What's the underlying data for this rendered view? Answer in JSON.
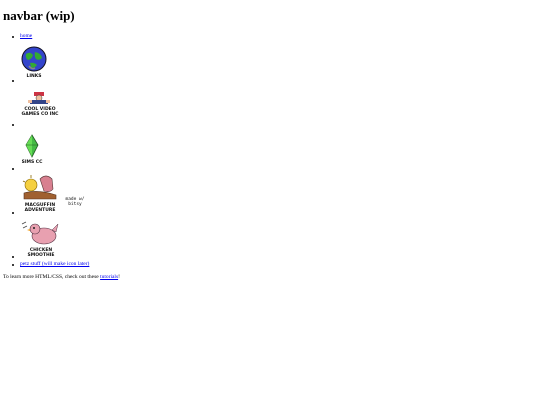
{
  "header": {
    "title": "navbar (wip)"
  },
  "nav": {
    "home_label": "home",
    "links_label": "LINKS",
    "cool_video_games_label": "COOL VIDEO GAMES CO INC",
    "sims_cc_label": "SIMS CC",
    "macguffin_label": "MACGUFFIN ADVENTURE",
    "made_with_bitsy_label": "made w/ bitsy",
    "chicken_smoothie_label": "CHICKEN SMOOTHIE",
    "petz_label": "petz stuff (will make icon later)"
  },
  "footer": {
    "prefix": "To learn more HTML/CSS, check out these ",
    "link_label": "tutorials",
    "suffix": "!"
  }
}
